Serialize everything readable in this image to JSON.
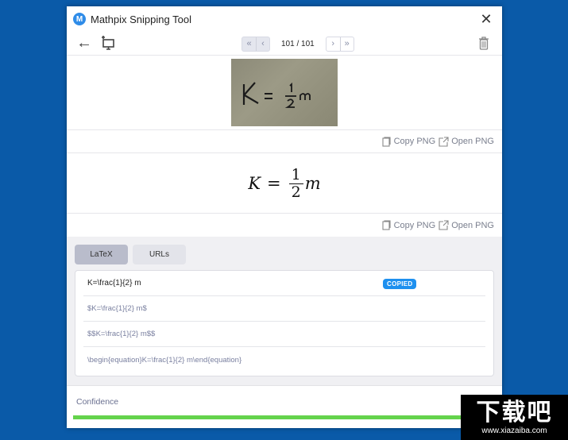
{
  "window": {
    "title": "Mathpix Snipping Tool",
    "logo_glyph": "M",
    "close_glyph": "✕"
  },
  "toolbar": {
    "back_glyph": "←",
    "first_glyph": "«",
    "prev_glyph": "‹",
    "next_glyph": "›",
    "last_glyph": "»",
    "page_indicator": "101 / 101"
  },
  "snip": {
    "handwritten_text": "K = 1/2 m"
  },
  "actions": {
    "copy_png": "Copy PNG",
    "open_png": "Open PNG"
  },
  "rendered": {
    "lhs": "K",
    "equals": "=",
    "numerator": "1",
    "denominator": "2",
    "rhs": "m"
  },
  "tabs": [
    {
      "label": "LaTeX",
      "active": true
    },
    {
      "label": "URLs",
      "active": false
    }
  ],
  "latex_items": [
    {
      "text": "K=\\frac{1}{2} m",
      "badge": "COPIED"
    },
    {
      "text": "$K=\\frac{1}{2} m$"
    },
    {
      "text": "$$K=\\frac{1}{2} m$$"
    },
    {
      "text": "\\begin{equation}K=\\frac{1}{2} m\\end{equation}"
    }
  ],
  "confidence": {
    "label": "Confidence",
    "value_percent": 100,
    "color": "#64d34c"
  },
  "colors": {
    "desktop": "#0a5aa8",
    "accent": "#1e90ef"
  },
  "watermark": {
    "main": "下载吧",
    "url": "www.xiazaiba.com"
  }
}
